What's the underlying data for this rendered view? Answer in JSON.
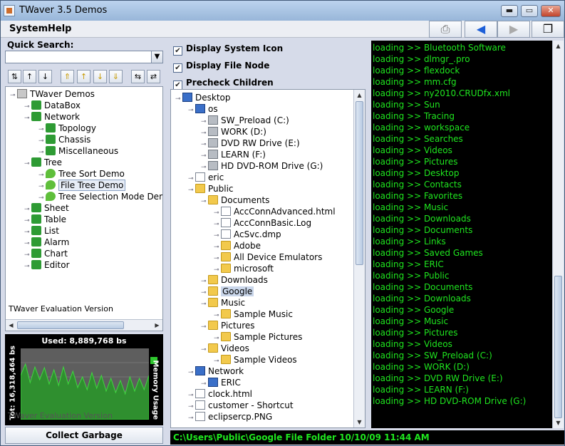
{
  "window": {
    "title": "TWaver 3.5 Demos",
    "min": "▬",
    "max": "▭",
    "close": "✕"
  },
  "menu": {
    "system": "System",
    "help": "Help"
  },
  "toolbar": {
    "b1": "⎙",
    "b2": "◀",
    "b3": "▶",
    "b4": "❐"
  },
  "quick_search": {
    "label": "Quick Search:",
    "value": ""
  },
  "left_tree": [
    {
      "label": "TWaver Demos",
      "indent": 0,
      "icon": "cube"
    },
    {
      "label": "DataBox",
      "indent": 1,
      "icon": "pz"
    },
    {
      "label": "Network",
      "indent": 1,
      "icon": "pz"
    },
    {
      "label": "Topology",
      "indent": 2,
      "icon": "pz"
    },
    {
      "label": "Chassis",
      "indent": 2,
      "icon": "pz"
    },
    {
      "label": "Miscellaneous",
      "indent": 2,
      "icon": "pz"
    },
    {
      "label": "Tree",
      "indent": 1,
      "icon": "pz"
    },
    {
      "label": "Tree Sort Demo",
      "indent": 2,
      "icon": "leaf"
    },
    {
      "label": "File Tree Demo",
      "indent": 2,
      "icon": "leaf",
      "selected": true
    },
    {
      "label": "Tree Selection Mode Demo",
      "indent": 2,
      "icon": "leaf"
    },
    {
      "label": "Sheet",
      "indent": 1,
      "icon": "pz"
    },
    {
      "label": "Table",
      "indent": 1,
      "icon": "pz"
    },
    {
      "label": "List",
      "indent": 1,
      "icon": "pz"
    },
    {
      "label": "Alarm",
      "indent": 1,
      "icon": "pz"
    },
    {
      "label": "Chart",
      "indent": 1,
      "icon": "pz"
    },
    {
      "label": "Editor",
      "indent": 1,
      "icon": "pz"
    }
  ],
  "eval_text": "TWaver Evaluation Version",
  "memory": {
    "used": "Used: 8,889,768 bs",
    "total": "Tot: 16,318,464 bs",
    "legend": "Memory Usage",
    "watermark": "TWaver Evaluation Version",
    "button": "Collect Garbage"
  },
  "options": {
    "system_icon": "Display System Icon",
    "file_node": "Display File Node",
    "precheck": "Precheck Children"
  },
  "file_tree": [
    {
      "label": "Desktop",
      "indent": 0,
      "icon": "pc"
    },
    {
      "label": "os",
      "indent": 1,
      "icon": "pc"
    },
    {
      "label": "SW_Preload (C:)",
      "indent": 2,
      "icon": "drive"
    },
    {
      "label": "WORK (D:)",
      "indent": 2,
      "icon": "drive"
    },
    {
      "label": "DVD RW Drive (E:)",
      "indent": 2,
      "icon": "drive"
    },
    {
      "label": "LEARN (F:)",
      "indent": 2,
      "icon": "drive"
    },
    {
      "label": "HD DVD-ROM Drive (G:)",
      "indent": 2,
      "icon": "drive"
    },
    {
      "label": "eric",
      "indent": 1,
      "icon": "file"
    },
    {
      "label": "Public",
      "indent": 1,
      "icon": "folder"
    },
    {
      "label": "Documents",
      "indent": 2,
      "icon": "folder"
    },
    {
      "label": "AccConnAdvanced.html",
      "indent": 3,
      "icon": "file"
    },
    {
      "label": "AccConnBasic.Log",
      "indent": 3,
      "icon": "file"
    },
    {
      "label": "AcSvc.dmp",
      "indent": 3,
      "icon": "file"
    },
    {
      "label": "Adobe",
      "indent": 3,
      "icon": "folder"
    },
    {
      "label": "All Device Emulators",
      "indent": 3,
      "icon": "folder"
    },
    {
      "label": "microsoft",
      "indent": 3,
      "icon": "folder"
    },
    {
      "label": "Downloads",
      "indent": 2,
      "icon": "folder"
    },
    {
      "label": "Google",
      "indent": 2,
      "icon": "folder",
      "selected": true
    },
    {
      "label": "Music",
      "indent": 2,
      "icon": "folder"
    },
    {
      "label": "Sample Music",
      "indent": 3,
      "icon": "folder"
    },
    {
      "label": "Pictures",
      "indent": 2,
      "icon": "folder"
    },
    {
      "label": "Sample Pictures",
      "indent": 3,
      "icon": "folder"
    },
    {
      "label": "Videos",
      "indent": 2,
      "icon": "folder"
    },
    {
      "label": "Sample Videos",
      "indent": 3,
      "icon": "folder"
    },
    {
      "label": "Network",
      "indent": 1,
      "icon": "pc"
    },
    {
      "label": "ERIC",
      "indent": 2,
      "icon": "pc"
    },
    {
      "label": "clock.html",
      "indent": 1,
      "icon": "file"
    },
    {
      "label": "customer - Shortcut",
      "indent": 1,
      "icon": "file"
    },
    {
      "label": "eclipsercp.PNG",
      "indent": 1,
      "icon": "file"
    }
  ],
  "log_lines": [
    "loading >> Bluetooth Software",
    "loading >> dlmgr_.pro",
    "loading >> flexdock",
    "loading >> mm.cfg",
    "loading >> ny2010.CRUDfx.xml",
    "loading >> Sun",
    "loading >> Tracing",
    "loading >> workspace",
    "loading >> Searches",
    "loading >> Videos",
    "loading >> Pictures",
    "loading >> Desktop",
    "loading >> Contacts",
    "loading >> Favorites",
    "loading >> Music",
    "loading >> Downloads",
    "loading >> Documents",
    "loading >> Links",
    "loading >> Saved Games",
    "loading >> ERIC",
    "loading >> Public",
    "loading >> Documents",
    "loading >> Downloads",
    "loading >> Google",
    "loading >> Music",
    "loading >> Pictures",
    "loading >> Videos",
    "loading >> SW_Preload (C:)",
    "loading >> WORK (D:)",
    "loading >> DVD RW Drive (E:)",
    "loading >> LEARN (F:)",
    "loading >> HD DVD-ROM Drive (G:)"
  ],
  "status": "C:\\Users\\Public\\Google File Folder 10/10/09 11:44 AM",
  "memory_samples": [
    0.62,
    0.78,
    0.52,
    0.74,
    0.56,
    0.73,
    0.5,
    0.7,
    0.48,
    0.74,
    0.5,
    0.68,
    0.45,
    0.6,
    0.42,
    0.66,
    0.44,
    0.62,
    0.4,
    0.58,
    0.38,
    0.55,
    0.36,
    0.6,
    0.4,
    0.58,
    0.42,
    0.62
  ],
  "colors": {
    "log_text": "#1fe61f",
    "memory_fill": "#2f8f2f"
  }
}
